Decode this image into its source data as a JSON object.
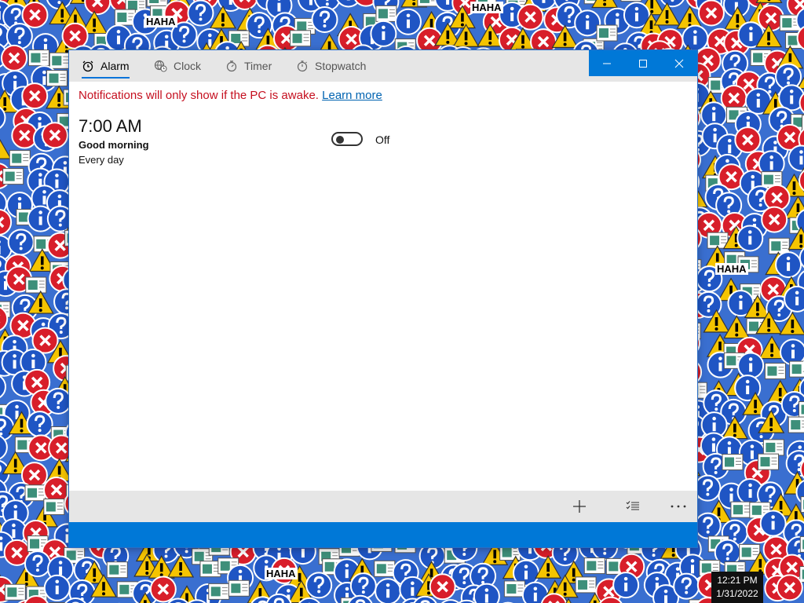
{
  "desktop": {
    "wallpaper_icons": [
      "error-icon",
      "info-icon",
      "warning-icon",
      "question-icon",
      "notepad-icon"
    ],
    "haha_labels": [
      "HAHA",
      "HAHA",
      "HAHA",
      "HAHA"
    ],
    "colors": {
      "error": "#d81e2a",
      "info": "#1f55c4",
      "warning": "#f5c400",
      "bg": "#3a6fd0"
    }
  },
  "window": {
    "tabs": [
      {
        "label": "Alarm",
        "icon": "alarm-clock-icon",
        "active": true
      },
      {
        "label": "Clock",
        "icon": "globe-clock-icon",
        "active": false
      },
      {
        "label": "Timer",
        "icon": "timer-icon",
        "active": false
      },
      {
        "label": "Stopwatch",
        "icon": "stopwatch-icon",
        "active": false
      }
    ],
    "caption": {
      "minimize": "minimize-icon",
      "maximize": "maximize-icon",
      "close": "close-icon"
    },
    "accent": "#0078d7",
    "notice": {
      "text": "Notifications will only show if the PC is awake.",
      "link": "Learn more"
    },
    "alarm": {
      "time": "7:00 AM",
      "name": "Good morning",
      "repeat": "Every day",
      "toggle_state": "Off"
    },
    "bottom_toolbar": [
      "add-icon",
      "select-alarms-icon",
      "more-icon"
    ]
  },
  "taskbar": {
    "time": "12:21 PM",
    "date": "1/31/2022"
  }
}
